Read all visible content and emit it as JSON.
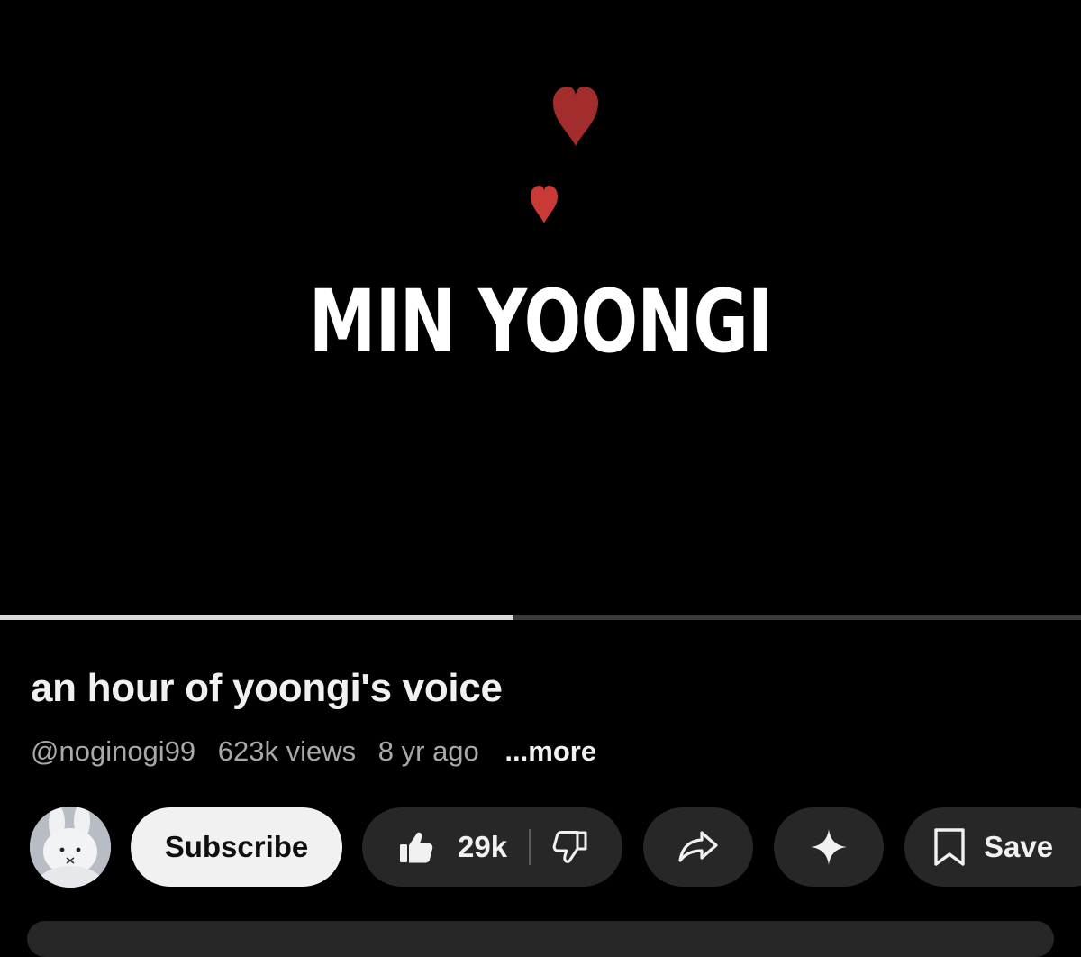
{
  "player": {
    "overlay_title": "MIN YOONGI",
    "progress": 0.475,
    "colors": {
      "heart_big": "#a32c2c",
      "heart_small": "#c93a36",
      "progress_fill": "#d9d9d9",
      "progress_track": "#3b3b3b"
    }
  },
  "video": {
    "title": "an hour of yoongi's voice",
    "channel": "@noginogi99",
    "views": "623k views",
    "age": "8 yr ago",
    "more_label": "...more"
  },
  "actions": {
    "subscribe_label": "Subscribe",
    "like_count": "29k",
    "save_label": "Save",
    "icons": [
      "thumbs-up-icon",
      "thumbs-down-icon",
      "share-icon",
      "sparkle-icon",
      "bookmark-icon"
    ]
  }
}
